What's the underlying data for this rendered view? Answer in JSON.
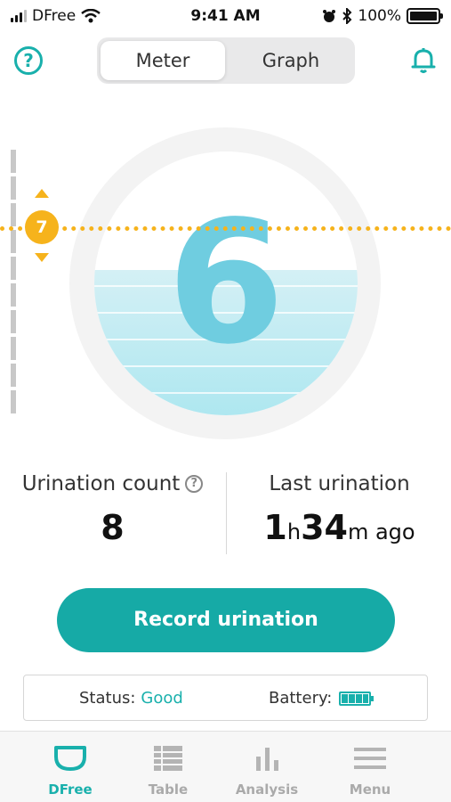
{
  "status_bar": {
    "carrier": "DFree",
    "time": "9:41 AM",
    "battery_percent": "100%"
  },
  "header": {
    "help_icon": "question-circle-icon",
    "tabs": [
      {
        "label": "Meter",
        "active": true
      },
      {
        "label": "Graph",
        "active": false
      }
    ],
    "bell_icon": "bell-icon"
  },
  "meter": {
    "level": "6",
    "threshold": "7",
    "fill_fraction": 0.55,
    "threshold_color": "#f6b31c",
    "fill_color": "#aee7f0"
  },
  "stats": {
    "count_label": "Urination count",
    "count_value": "8",
    "last_label": "Last urination",
    "last_hours": "1",
    "last_h_unit": "h",
    "last_minutes": "34",
    "last_m_unit": "m ago"
  },
  "record_button": {
    "label": "Record urination"
  },
  "device_status": {
    "status_label": "Status:",
    "status_value": "Good",
    "battery_label": "Battery:"
  },
  "tab_bar": {
    "items": [
      {
        "label": "DFree",
        "icon": "dfree-icon",
        "active": true
      },
      {
        "label": "Table",
        "icon": "table-icon",
        "active": false
      },
      {
        "label": "Analysis",
        "icon": "bar-chart-icon",
        "active": false
      },
      {
        "label": "Menu",
        "icon": "hamburger-icon",
        "active": false
      }
    ]
  },
  "colors": {
    "accent": "#19b0ac",
    "button": "#16aaa6"
  }
}
